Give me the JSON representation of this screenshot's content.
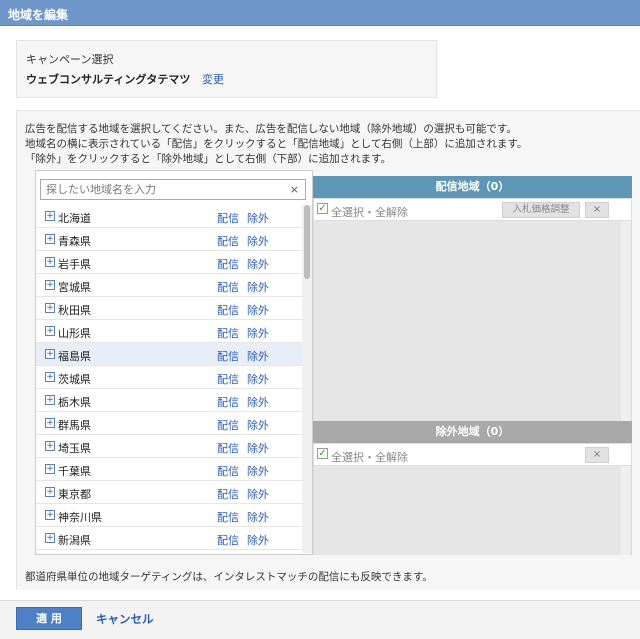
{
  "window": {
    "title": "地域を編集"
  },
  "campaign": {
    "label": "キャンペーン選択",
    "name": "ウェブコンサルティングタテマツ",
    "change_label": "変更"
  },
  "instructions": [
    "広告を配信する地域を選択してください。また、広告を配信しない地域（除外地域）の選択も可能です。",
    "地域名の横に表示されている「配信」をクリックすると「配信地域」として右側（上部）に追加されます。",
    "「除外」をクリックすると「除外地域」として右側（下部）に追加されます。"
  ],
  "search": {
    "placeholder": "探したい地域名を入力",
    "clear_icon": "×"
  },
  "region_list": {
    "deliver_label": "配信",
    "exclude_label": "除外",
    "expand_icon": "+",
    "items": [
      "北海道",
      "青森県",
      "岩手県",
      "宮城県",
      "秋田県",
      "山形県",
      "福島県",
      "茨城県",
      "栃木県",
      "群馬県",
      "埼玉県",
      "千葉県",
      "東京都",
      "神奈川県",
      "新潟県"
    ],
    "highlighted_index": 6
  },
  "delivery_panel": {
    "title": "配信地域（0）",
    "select_all": "全選択・全解除",
    "bid_adjust_label": "入札価格調整",
    "remove_icon": "×"
  },
  "exclusion_panel": {
    "title": "除外地域（0）",
    "select_all": "全選択・全解除",
    "remove_icon": "×"
  },
  "footnote": "都道府県単位の地域ターゲティングは、インタレストマッチの配信にも反映できます。",
  "footer": {
    "apply_label": "適 用",
    "cancel_label": "キャンセル"
  },
  "colors": {
    "title_bar": "#6f97c9",
    "delivery_header": "#5e97b6",
    "exclusion_header": "#a9a9a9",
    "link": "#2a5db0"
  }
}
